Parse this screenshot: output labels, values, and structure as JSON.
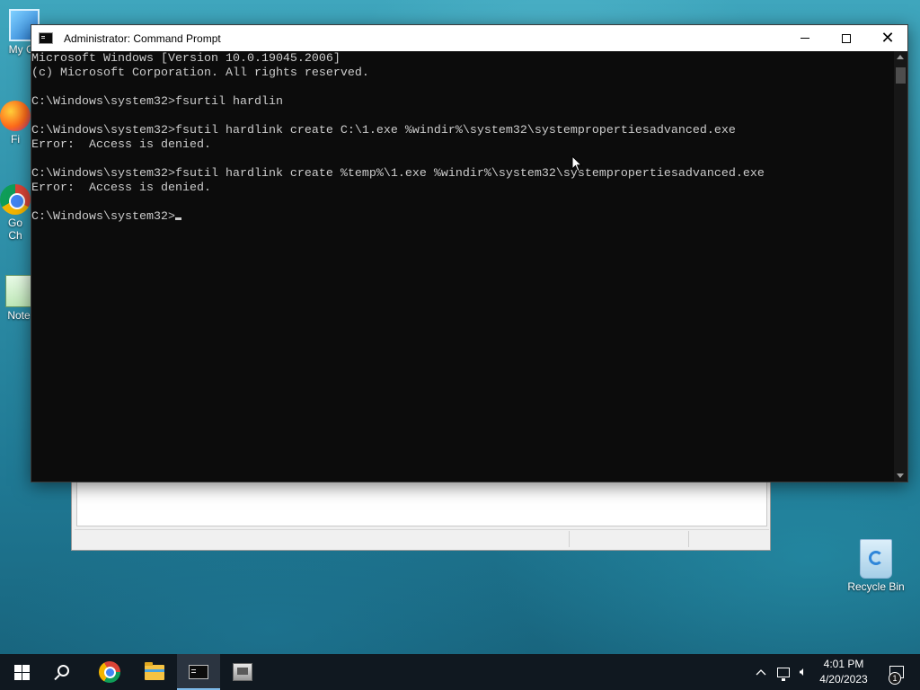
{
  "desktop": {
    "icons": [
      {
        "label": "My Co"
      },
      {
        "label": "Fi"
      },
      {
        "label": "Go\nCh"
      },
      {
        "label": "Note"
      }
    ],
    "recycle_bin_label": "Recycle Bin"
  },
  "cmd_window": {
    "title": "Administrator: Command Prompt",
    "lines": [
      "Microsoft Windows [Version 10.0.19045.2006]",
      "(c) Microsoft Corporation. All rights reserved.",
      "",
      "C:\\Windows\\system32>fsurtil hardlin",
      "",
      "C:\\Windows\\system32>fsutil hardlink create C:\\1.exe %windir%\\system32\\systempropertiesadvanced.exe",
      "Error:  Access is denied.",
      "",
      "C:\\Windows\\system32>fsutil hardlink create %temp%\\1.exe %windir%\\system32\\systempropertiesadvanced.exe",
      "Error:  Access is denied.",
      "",
      "C:\\Windows\\system32>"
    ]
  },
  "taskbar": {
    "items": [
      "start",
      "search",
      "chrome",
      "file-explorer",
      "command-prompt",
      "system-properties"
    ],
    "active_item": "command-prompt",
    "clock": {
      "time": "4:01 PM",
      "date": "4/20/2023"
    },
    "notification_count": "1"
  },
  "colors": {
    "console_bg": "#0c0c0c",
    "console_text": "#cccccc",
    "taskbar_bg": "#101820"
  }
}
